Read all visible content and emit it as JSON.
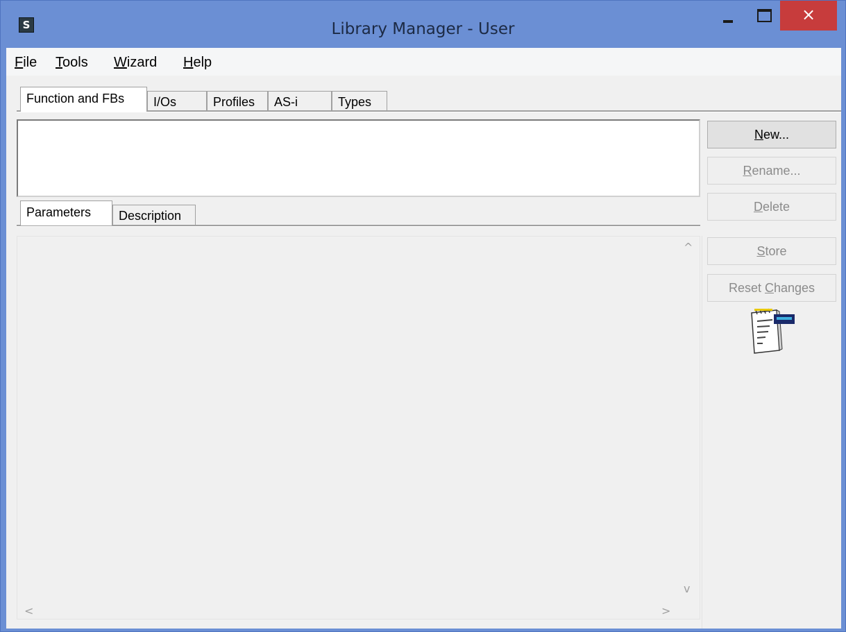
{
  "window": {
    "title": "Library Manager - User",
    "app_icon_letter": "S",
    "close_glyph": "×"
  },
  "menu": {
    "items": [
      {
        "label": "File",
        "accel": "F",
        "rest": "ile"
      },
      {
        "label": "Tools",
        "accel": "T",
        "rest": "ools"
      },
      {
        "label": "Wizard",
        "accel": "W",
        "rest": "izard"
      },
      {
        "label": "Help",
        "accel": "H",
        "rest": "elp"
      }
    ]
  },
  "top_tabs": [
    {
      "label": "Function and FBs",
      "active": true
    },
    {
      "label": "I/Os",
      "active": false
    },
    {
      "label": "Profiles",
      "active": false
    },
    {
      "label": "AS-i",
      "active": false
    },
    {
      "label": "Types",
      "active": false
    }
  ],
  "bottom_tabs": [
    {
      "label": "Parameters",
      "active": true
    },
    {
      "label": "Description",
      "active": false
    }
  ],
  "buttons": {
    "new": {
      "label": "New...",
      "accel": "N",
      "rest": "ew...",
      "enabled": true
    },
    "rename": {
      "label": "Rename...",
      "accel": "R",
      "rest": "ename...",
      "enabled": false
    },
    "delete": {
      "label": "Delete",
      "accel": "D",
      "rest": "elete",
      "enabled": false
    },
    "store": {
      "label": "Store",
      "accel": "S",
      "rest": "tore",
      "enabled": false
    },
    "reset": {
      "label": "Reset Changes",
      "prefix": "Reset ",
      "accel": "C",
      "rest": "hanges",
      "enabled": false
    }
  },
  "scroll": {
    "up": "^",
    "down": "v",
    "left": "<",
    "right": ">"
  },
  "icons": {
    "app": "app-icon",
    "notepad": "notepad-icon"
  },
  "colors": {
    "titlebar": "#6b8fd4",
    "close": "#c73c3c",
    "client": "#f0f0f0"
  }
}
